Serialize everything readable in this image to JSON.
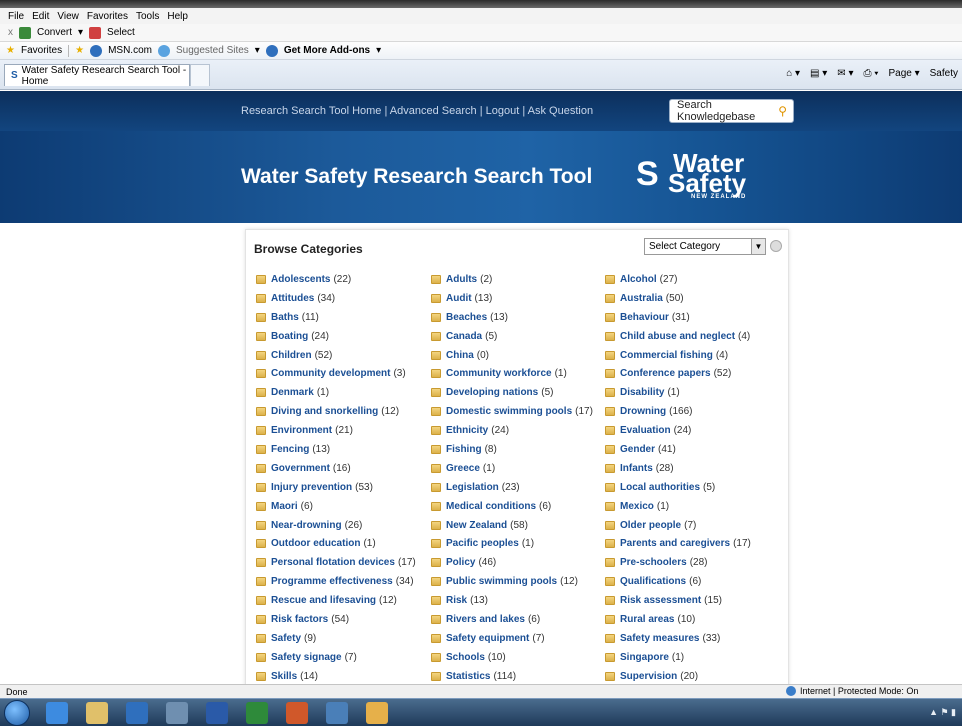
{
  "menu": [
    "File",
    "Edit",
    "View",
    "Favorites",
    "Tools",
    "Help"
  ],
  "cmdbar": {
    "close": "x",
    "convert": "Convert",
    "select": "Select"
  },
  "favbar": {
    "favorites": "Favorites",
    "msn": "MSN.com",
    "suggested": "Suggested Sites",
    "addons": "Get More Add-ons"
  },
  "tab": {
    "title": "Water Safety Research Search Tool - Home"
  },
  "toolbar_right": {
    "page": "Page",
    "safety": "Safety"
  },
  "site": {
    "nav_links": [
      "Research Search Tool Home",
      "Advanced Search",
      "Logout",
      "Ask Question"
    ],
    "search_placeholder": "Search Knowledgebase",
    "title": "Water Safety Research Search Tool",
    "logo": {
      "line1": "Water",
      "line2": "Safety",
      "line3": "NEW ZEALAND"
    }
  },
  "browse": {
    "heading": "Browse Categories",
    "select_value": "Select Category",
    "categories": [
      {
        "name": "Adolescents",
        "count": "(22)"
      },
      {
        "name": "Adults",
        "count": "(2)"
      },
      {
        "name": "Alcohol",
        "count": "(27)"
      },
      {
        "name": "Attitudes",
        "count": "(34)"
      },
      {
        "name": "Audit",
        "count": "(13)"
      },
      {
        "name": "Australia",
        "count": "(50)"
      },
      {
        "name": "Baths",
        "count": "(11)"
      },
      {
        "name": "Beaches",
        "count": "(13)"
      },
      {
        "name": "Behaviour",
        "count": "(31)"
      },
      {
        "name": "Boating",
        "count": "(24)"
      },
      {
        "name": "Canada",
        "count": "(5)"
      },
      {
        "name": "Child abuse and neglect",
        "count": "(4)"
      },
      {
        "name": "Children",
        "count": "(52)"
      },
      {
        "name": "China",
        "count": "(0)"
      },
      {
        "name": "Commercial fishing",
        "count": "(4)"
      },
      {
        "name": "Community development",
        "count": "(3)"
      },
      {
        "name": "Community workforce",
        "count": "(1)"
      },
      {
        "name": "Conference papers",
        "count": "(52)"
      },
      {
        "name": "Denmark",
        "count": "(1)"
      },
      {
        "name": "Developing nations",
        "count": "(5)"
      },
      {
        "name": "Disability",
        "count": "(1)"
      },
      {
        "name": "Diving and snorkelling",
        "count": "(12)"
      },
      {
        "name": "Domestic swimming pools",
        "count": "(17)"
      },
      {
        "name": "Drowning",
        "count": "(166)"
      },
      {
        "name": "Environment",
        "count": "(21)"
      },
      {
        "name": "Ethnicity",
        "count": "(24)"
      },
      {
        "name": "Evaluation",
        "count": "(24)"
      },
      {
        "name": "Fencing",
        "count": "(13)"
      },
      {
        "name": "Fishing",
        "count": "(8)"
      },
      {
        "name": "Gender",
        "count": "(41)"
      },
      {
        "name": "Government",
        "count": "(16)"
      },
      {
        "name": "Greece",
        "count": "(1)"
      },
      {
        "name": "Infants",
        "count": "(28)"
      },
      {
        "name": "Injury prevention",
        "count": "(53)"
      },
      {
        "name": "Legislation",
        "count": "(23)"
      },
      {
        "name": "Local authorities",
        "count": "(5)"
      },
      {
        "name": "Maori",
        "count": "(6)"
      },
      {
        "name": "Medical conditions",
        "count": "(6)"
      },
      {
        "name": "Mexico",
        "count": "(1)"
      },
      {
        "name": "Near-drowning",
        "count": "(26)"
      },
      {
        "name": "New Zealand",
        "count": "(58)"
      },
      {
        "name": "Older people",
        "count": "(7)"
      },
      {
        "name": "Outdoor education",
        "count": "(1)"
      },
      {
        "name": "Pacific peoples",
        "count": "(1)"
      },
      {
        "name": "Parents and caregivers",
        "count": "(17)"
      },
      {
        "name": "Personal flotation devices",
        "count": "(17)"
      },
      {
        "name": "Policy",
        "count": "(46)"
      },
      {
        "name": "Pre-schoolers",
        "count": "(28)"
      },
      {
        "name": "Programme effectiveness",
        "count": "(34)"
      },
      {
        "name": "Public swimming pools",
        "count": "(12)"
      },
      {
        "name": "Qualifications",
        "count": "(6)"
      },
      {
        "name": "Rescue and lifesaving",
        "count": "(12)"
      },
      {
        "name": "Risk",
        "count": "(13)"
      },
      {
        "name": "Risk assessment",
        "count": "(15)"
      },
      {
        "name": "Risk factors",
        "count": "(54)"
      },
      {
        "name": "Rivers and lakes",
        "count": "(6)"
      },
      {
        "name": "Rural areas",
        "count": "(10)"
      },
      {
        "name": "Safety",
        "count": "(9)"
      },
      {
        "name": "Safety equipment",
        "count": "(7)"
      },
      {
        "name": "Safety measures",
        "count": "(33)"
      },
      {
        "name": "Safety signage",
        "count": "(7)"
      },
      {
        "name": "Schools",
        "count": "(10)"
      },
      {
        "name": "Singapore",
        "count": "(1)"
      },
      {
        "name": "Skills",
        "count": "(14)"
      },
      {
        "name": "Statistics",
        "count": "(114)"
      },
      {
        "name": "Supervision",
        "count": "(20)"
      }
    ]
  },
  "status": {
    "left": "Done",
    "right": "Internet | Protected Mode: On"
  },
  "colors": {
    "header": "#0e3c72",
    "link": "#1b4f94",
    "folder": "#e8c466"
  }
}
